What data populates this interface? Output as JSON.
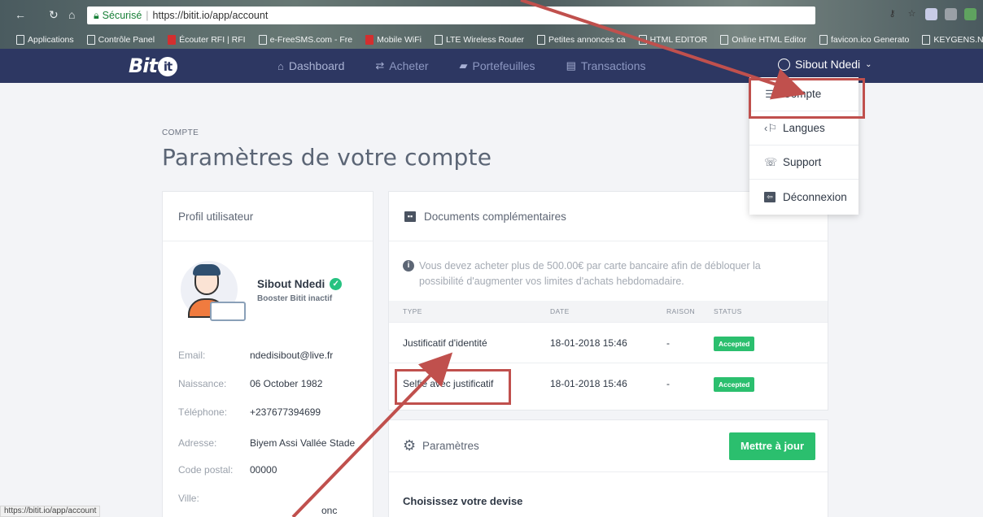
{
  "browser": {
    "security_label": "Sécurisé",
    "url": "https://bitit.io/app/account",
    "status_url": "https://bitit.io/app/account",
    "bookmarks": [
      "Applications",
      "Contrôle Panel",
      "Écouter RFI | RFI",
      "e-FreeSMS.com - Fre",
      "Mobile WiFi",
      "LTE Wireless Router",
      "Petites annonces ca",
      "HTML EDITOR",
      "Online HTML Editor",
      "favicon.ico Generato",
      "KEYGENS.NL - Gene"
    ]
  },
  "app": {
    "logo_text": "Bit",
    "logo_circle": "it",
    "nav": [
      {
        "label": "Dashboard",
        "icon": "home-icon"
      },
      {
        "label": "Acheter",
        "icon": "exchange-icon"
      },
      {
        "label": "Portefeuilles",
        "icon": "wallet-icon"
      },
      {
        "label": "Transactions",
        "icon": "transactions-icon"
      }
    ],
    "user_name": "Sibout Ndedi",
    "accent_color": "#2d3762",
    "success_color": "#2bbf6e"
  },
  "page": {
    "breadcrumb": "COMPTE",
    "title": "Paramètres de votre compte"
  },
  "profile": {
    "header": "Profil utilisateur",
    "name": "Sibout Ndedi",
    "status": "Booster Bitit inactif",
    "fields": [
      {
        "key": "Email:",
        "value": "ndedisibout@live.fr"
      },
      {
        "key": "Naissance:",
        "value": "06 October 1982"
      },
      {
        "key": "Téléphone:",
        "value": "+237677394699"
      },
      {
        "key": "Adresse:",
        "value": "Biyem Assi Vallée Stade"
      },
      {
        "key": "Code postal:",
        "value": "00000"
      },
      {
        "key": "Ville:",
        "value": ""
      }
    ],
    "ville_fragment": "onc"
  },
  "documents": {
    "header": "Documents complémentaires",
    "notice": "Vous devez acheter plus de 500.00€ par carte bancaire afin de débloquer la possibilité d'augmenter vos limites d'achats hebdomadaire.",
    "columns": [
      "TYPE",
      "DATE",
      "RAISON",
      "STATUS"
    ],
    "rows": [
      {
        "type": "Justificatif d'identité",
        "date": "18-01-2018 15:46",
        "reason": "-",
        "status": "Accepted"
      },
      {
        "type": "Selfie avec justificatif",
        "date": "18-01-2018 15:46",
        "reason": "-",
        "status": "Accepted"
      }
    ]
  },
  "params": {
    "header": "Paramètres",
    "update_button": "Mettre à jour",
    "currency_label": "Choisissez votre devise"
  },
  "dropdown": {
    "items": [
      {
        "label": "Compte",
        "icon": "sliders-icon"
      },
      {
        "label": "Langues",
        "icon": "language-icon"
      },
      {
        "label": "Support",
        "icon": "support-icon"
      },
      {
        "label": "Déconnexion",
        "icon": "logout-icon"
      }
    ]
  },
  "annotation_color": "#c0504d"
}
